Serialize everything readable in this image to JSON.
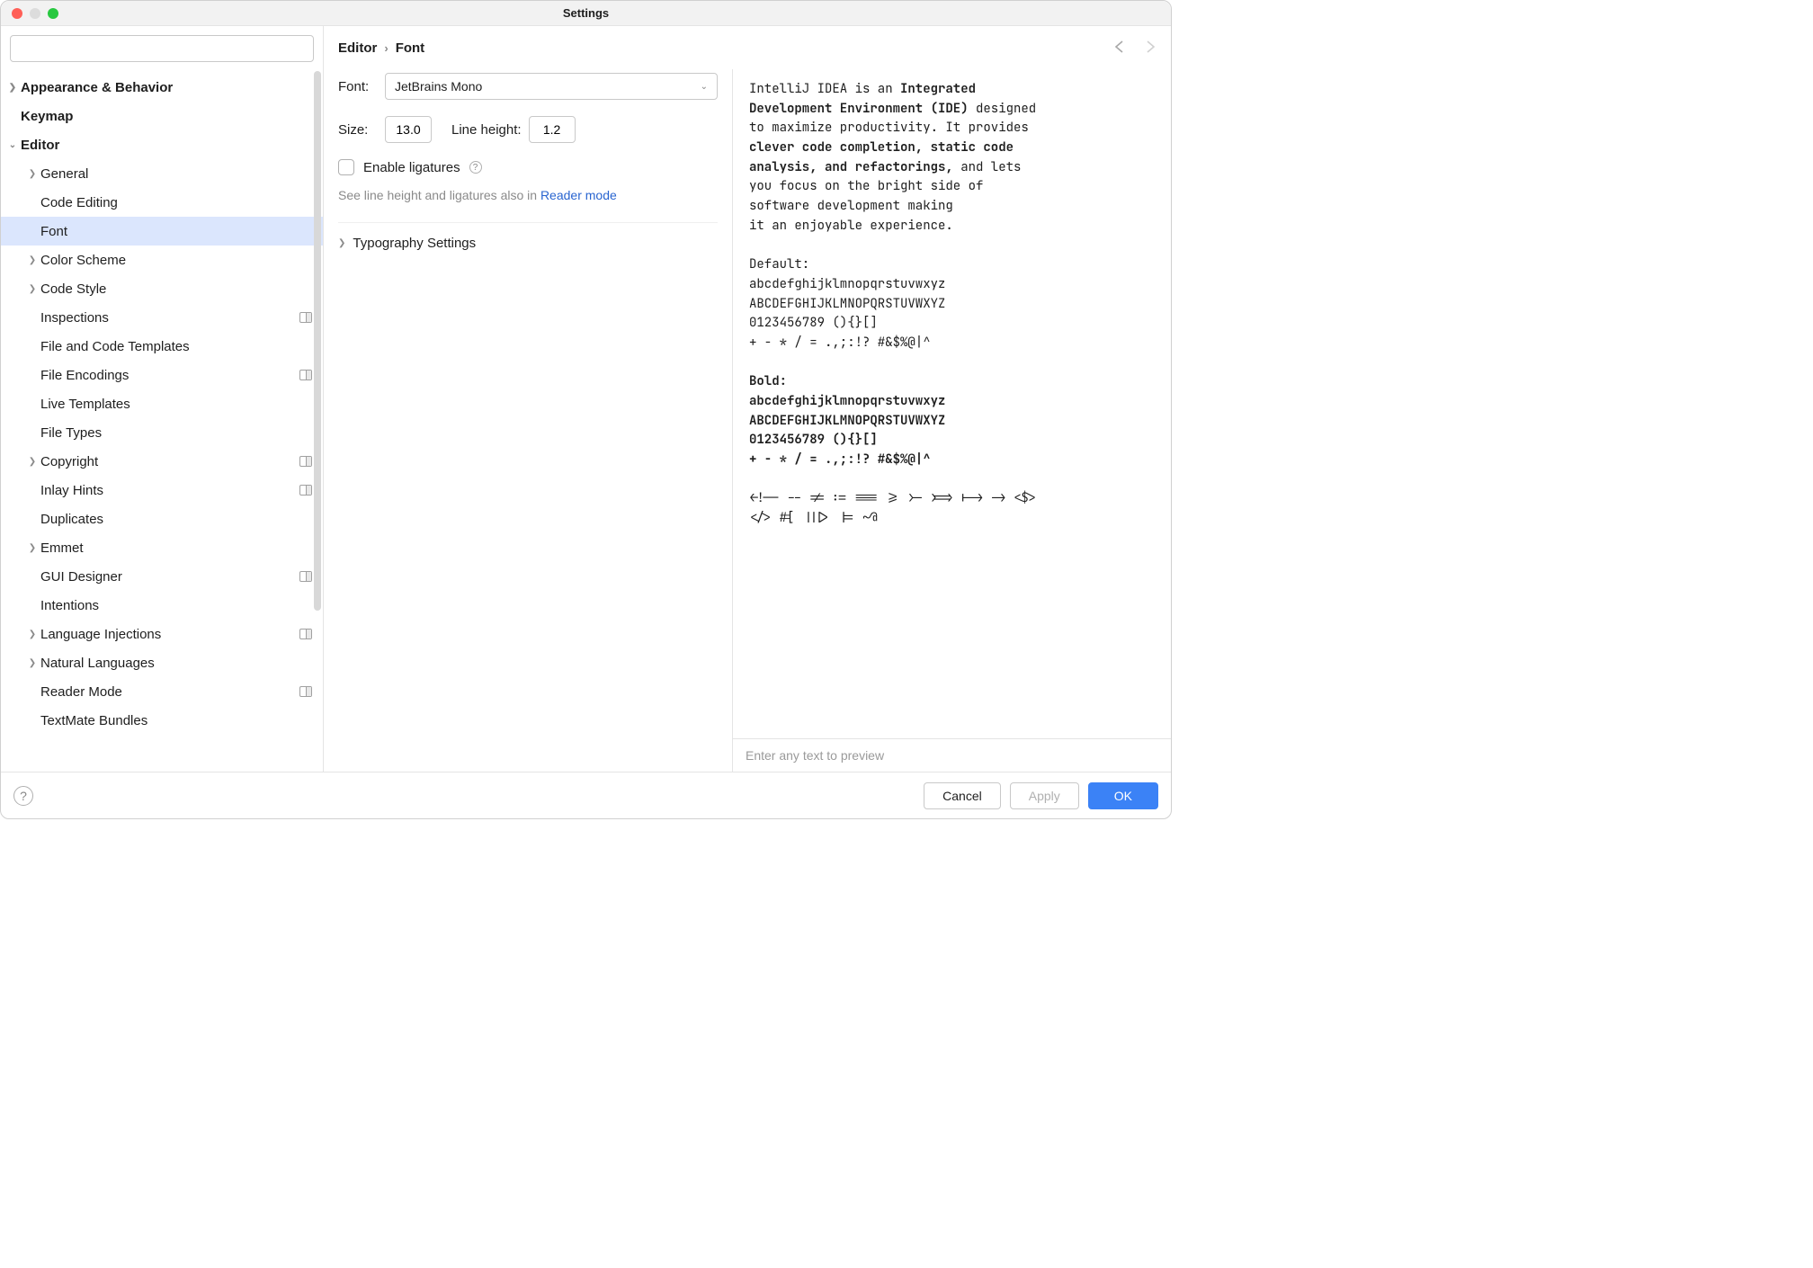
{
  "window": {
    "title": "Settings"
  },
  "search": {
    "placeholder": ""
  },
  "sidebar": {
    "items": [
      {
        "label": "Appearance & Behavior",
        "level": 0,
        "arrow": "right",
        "bold": true
      },
      {
        "label": "Keymap",
        "level": 0,
        "arrow": "",
        "bold": true
      },
      {
        "label": "Editor",
        "level": 0,
        "arrow": "down",
        "bold": true
      },
      {
        "label": "General",
        "level": 1,
        "arrow": "right"
      },
      {
        "label": "Code Editing",
        "level": 1,
        "arrow": ""
      },
      {
        "label": "Font",
        "level": 1,
        "arrow": "",
        "selected": true
      },
      {
        "label": "Color Scheme",
        "level": 1,
        "arrow": "right"
      },
      {
        "label": "Code Style",
        "level": 1,
        "arrow": "right"
      },
      {
        "label": "Inspections",
        "level": 1,
        "arrow": "",
        "badge": true
      },
      {
        "label": "File and Code Templates",
        "level": 1,
        "arrow": ""
      },
      {
        "label": "File Encodings",
        "level": 1,
        "arrow": "",
        "badge": true
      },
      {
        "label": "Live Templates",
        "level": 1,
        "arrow": ""
      },
      {
        "label": "File Types",
        "level": 1,
        "arrow": ""
      },
      {
        "label": "Copyright",
        "level": 1,
        "arrow": "right",
        "badge": true
      },
      {
        "label": "Inlay Hints",
        "level": 1,
        "arrow": "",
        "badge": true
      },
      {
        "label": "Duplicates",
        "level": 1,
        "arrow": ""
      },
      {
        "label": "Emmet",
        "level": 1,
        "arrow": "right"
      },
      {
        "label": "GUI Designer",
        "level": 1,
        "arrow": "",
        "badge": true
      },
      {
        "label": "Intentions",
        "level": 1,
        "arrow": ""
      },
      {
        "label": "Language Injections",
        "level": 1,
        "arrow": "right",
        "badge": true
      },
      {
        "label": "Natural Languages",
        "level": 1,
        "arrow": "right"
      },
      {
        "label": "Reader Mode",
        "level": 1,
        "arrow": "",
        "badge": true
      },
      {
        "label": "TextMate Bundles",
        "level": 1,
        "arrow": ""
      }
    ]
  },
  "breadcrumb": {
    "root": "Editor",
    "leaf": "Font"
  },
  "form": {
    "font_label": "Font:",
    "font_value": "JetBrains Mono",
    "size_label": "Size:",
    "size_value": "13.0",
    "lineheight_label": "Line height:",
    "lineheight_value": "1.2",
    "ligatures_label": "Enable ligatures",
    "hint_prefix": "See line height and ligatures also in ",
    "hint_link": "Reader mode",
    "typography_label": "Typography Settings"
  },
  "preview": {
    "line1a": "IntelliJ IDEA is an ",
    "line1b": "Integrated",
    "line2a": "Development Environment (IDE)",
    "line2b": " designed",
    "line3": "to maximize productivity. It provides",
    "line4": "clever code completion, static code",
    "line5a": "analysis, and refactorings,",
    "line5b": " and lets",
    "line6": "you focus on the bright side of",
    "line7": "software development making",
    "line8": "it an enjoyable experience.",
    "default_label": "Default:",
    "abc_lower": "abcdefghijklmnopqrstuvwxyz",
    "abc_upper": "ABCDEFGHIJKLMNOPQRSTUVWXYZ",
    "digits": "0123456789 (){}[]",
    "syms": "+ - * / = .,;:!? #&$%@|^",
    "bold_label": "Bold:",
    "ligline1": "<!-- -- != := === >= >- >=> |-> -> <$>",
    "ligline2": "</> #[ |||> |= ~@",
    "input_placeholder": "Enter any text to preview"
  },
  "footer": {
    "cancel": "Cancel",
    "apply": "Apply",
    "ok": "OK"
  }
}
